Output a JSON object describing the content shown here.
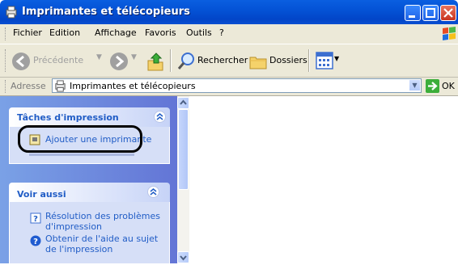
{
  "window": {
    "title": "Imprimantes et télécopieurs"
  },
  "menu": [
    "Fichier",
    "Edition",
    "Affichage",
    "Favoris",
    "Outils",
    "?"
  ],
  "toolbar": {
    "back_label": "Précédente",
    "search_label": "Rechercher",
    "folders_label": "Dossiers"
  },
  "address": {
    "label": "Adresse",
    "value": "Imprimantes et télécopieurs",
    "go_label": "OK"
  },
  "tasks_panel": {
    "title": "Tâches d'impression",
    "items": [
      {
        "label": "Ajouter une imprimante",
        "icon": "add-printer-icon"
      }
    ]
  },
  "see_also_panel": {
    "title": "Voir aussi",
    "items": [
      {
        "label": "Résolution des problèmes d'impression",
        "icon": "help-icon"
      },
      {
        "label": "Obtenir de l'aide au sujet de l'impression",
        "icon": "help-circle-icon"
      }
    ]
  },
  "colors": {
    "title_bar": "#0453d6",
    "task_pane": "#6375d6",
    "link": "#215dc6",
    "chrome": "#ece9d8"
  }
}
